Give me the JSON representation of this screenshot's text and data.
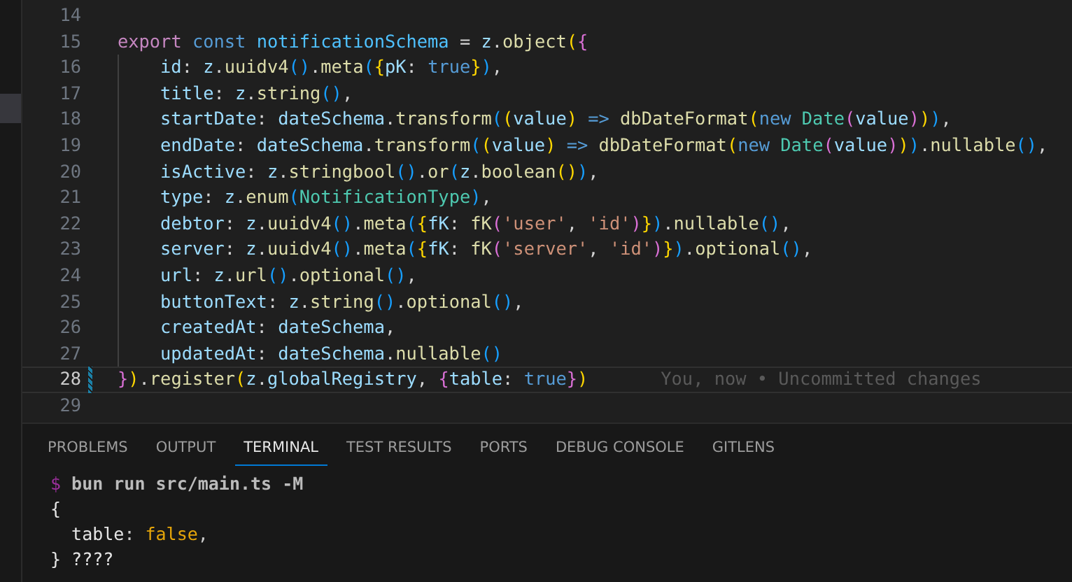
{
  "editor": {
    "lines": [
      {
        "number": "14",
        "current": false,
        "changed": false,
        "indented": false
      },
      {
        "number": "15",
        "current": false,
        "changed": false,
        "indented": false,
        "tokens": [
          {
            "kind": "ctl",
            "text": "export "
          },
          {
            "kind": "kw",
            "text": "const "
          },
          {
            "kind": "const",
            "text": "notificationSchema"
          },
          {
            "kind": "plain",
            "text": " = "
          },
          {
            "kind": "var",
            "text": "z"
          },
          {
            "kind": "plain",
            "text": "."
          },
          {
            "kind": "fn",
            "text": "object"
          },
          {
            "kind": "b1",
            "text": "("
          },
          {
            "kind": "b2",
            "text": "{"
          }
        ]
      },
      {
        "number": "16",
        "current": false,
        "changed": false,
        "indented": true,
        "tokens": [
          {
            "kind": "var",
            "text": "id"
          },
          {
            "kind": "plain",
            "text": ": "
          },
          {
            "kind": "var",
            "text": "z"
          },
          {
            "kind": "plain",
            "text": "."
          },
          {
            "kind": "fn",
            "text": "uuidv4"
          },
          {
            "kind": "b3",
            "text": "()"
          },
          {
            "kind": "plain",
            "text": "."
          },
          {
            "kind": "fn",
            "text": "meta"
          },
          {
            "kind": "b3",
            "text": "("
          },
          {
            "kind": "b1",
            "text": "{"
          },
          {
            "kind": "var",
            "text": "pK"
          },
          {
            "kind": "plain",
            "text": ": "
          },
          {
            "kind": "kw",
            "text": "true"
          },
          {
            "kind": "b1",
            "text": "}"
          },
          {
            "kind": "b3",
            "text": ")"
          },
          {
            "kind": "plain",
            "text": ","
          }
        ]
      },
      {
        "number": "17",
        "current": false,
        "changed": false,
        "indented": true,
        "tokens": [
          {
            "kind": "var",
            "text": "title"
          },
          {
            "kind": "plain",
            "text": ": "
          },
          {
            "kind": "var",
            "text": "z"
          },
          {
            "kind": "plain",
            "text": "."
          },
          {
            "kind": "fn",
            "text": "string"
          },
          {
            "kind": "b3",
            "text": "()"
          },
          {
            "kind": "plain",
            "text": ","
          }
        ]
      },
      {
        "number": "18",
        "current": false,
        "changed": false,
        "indented": true,
        "tokens": [
          {
            "kind": "var",
            "text": "startDate"
          },
          {
            "kind": "plain",
            "text": ": "
          },
          {
            "kind": "var",
            "text": "dateSchema"
          },
          {
            "kind": "plain",
            "text": "."
          },
          {
            "kind": "fn",
            "text": "transform"
          },
          {
            "kind": "b3",
            "text": "("
          },
          {
            "kind": "b1",
            "text": "("
          },
          {
            "kind": "var",
            "text": "value"
          },
          {
            "kind": "b1",
            "text": ")"
          },
          {
            "kind": "kw",
            "text": " => "
          },
          {
            "kind": "fn",
            "text": "dbDateFormat"
          },
          {
            "kind": "b1",
            "text": "("
          },
          {
            "kind": "kw",
            "text": "new "
          },
          {
            "kind": "type",
            "text": "Date"
          },
          {
            "kind": "b2",
            "text": "("
          },
          {
            "kind": "var",
            "text": "value"
          },
          {
            "kind": "b2",
            "text": ")"
          },
          {
            "kind": "b1",
            "text": ")"
          },
          {
            "kind": "b3",
            "text": ")"
          },
          {
            "kind": "plain",
            "text": ","
          }
        ]
      },
      {
        "number": "19",
        "current": false,
        "changed": false,
        "indented": true,
        "tokens": [
          {
            "kind": "var",
            "text": "endDate"
          },
          {
            "kind": "plain",
            "text": ": "
          },
          {
            "kind": "var",
            "text": "dateSchema"
          },
          {
            "kind": "plain",
            "text": "."
          },
          {
            "kind": "fn",
            "text": "transform"
          },
          {
            "kind": "b3",
            "text": "("
          },
          {
            "kind": "b1",
            "text": "("
          },
          {
            "kind": "var",
            "text": "value"
          },
          {
            "kind": "b1",
            "text": ")"
          },
          {
            "kind": "kw",
            "text": " => "
          },
          {
            "kind": "fn",
            "text": "dbDateFormat"
          },
          {
            "kind": "b1",
            "text": "("
          },
          {
            "kind": "kw",
            "text": "new "
          },
          {
            "kind": "type",
            "text": "Date"
          },
          {
            "kind": "b2",
            "text": "("
          },
          {
            "kind": "var",
            "text": "value"
          },
          {
            "kind": "b2",
            "text": ")"
          },
          {
            "kind": "b1",
            "text": ")"
          },
          {
            "kind": "b3",
            "text": ")"
          },
          {
            "kind": "plain",
            "text": "."
          },
          {
            "kind": "fn",
            "text": "nullable"
          },
          {
            "kind": "b3",
            "text": "()"
          },
          {
            "kind": "plain",
            "text": ","
          }
        ]
      },
      {
        "number": "20",
        "current": false,
        "changed": false,
        "indented": true,
        "tokens": [
          {
            "kind": "var",
            "text": "isActive"
          },
          {
            "kind": "plain",
            "text": ": "
          },
          {
            "kind": "var",
            "text": "z"
          },
          {
            "kind": "plain",
            "text": "."
          },
          {
            "kind": "fn",
            "text": "stringbool"
          },
          {
            "kind": "b3",
            "text": "()"
          },
          {
            "kind": "plain",
            "text": "."
          },
          {
            "kind": "fn",
            "text": "or"
          },
          {
            "kind": "b3",
            "text": "("
          },
          {
            "kind": "var",
            "text": "z"
          },
          {
            "kind": "plain",
            "text": "."
          },
          {
            "kind": "fn",
            "text": "boolean"
          },
          {
            "kind": "b1",
            "text": "()"
          },
          {
            "kind": "b3",
            "text": ")"
          },
          {
            "kind": "plain",
            "text": ","
          }
        ]
      },
      {
        "number": "21",
        "current": false,
        "changed": false,
        "indented": true,
        "tokens": [
          {
            "kind": "var",
            "text": "type"
          },
          {
            "kind": "plain",
            "text": ": "
          },
          {
            "kind": "var",
            "text": "z"
          },
          {
            "kind": "plain",
            "text": "."
          },
          {
            "kind": "fn",
            "text": "enum"
          },
          {
            "kind": "b3",
            "text": "("
          },
          {
            "kind": "type",
            "text": "NotificationType"
          },
          {
            "kind": "b3",
            "text": ")"
          },
          {
            "kind": "plain",
            "text": ","
          }
        ]
      },
      {
        "number": "22",
        "current": false,
        "changed": false,
        "indented": true,
        "tokens": [
          {
            "kind": "var",
            "text": "debtor"
          },
          {
            "kind": "plain",
            "text": ": "
          },
          {
            "kind": "var",
            "text": "z"
          },
          {
            "kind": "plain",
            "text": "."
          },
          {
            "kind": "fn",
            "text": "uuidv4"
          },
          {
            "kind": "b3",
            "text": "()"
          },
          {
            "kind": "plain",
            "text": "."
          },
          {
            "kind": "fn",
            "text": "meta"
          },
          {
            "kind": "b3",
            "text": "("
          },
          {
            "kind": "b1",
            "text": "{"
          },
          {
            "kind": "var",
            "text": "fK"
          },
          {
            "kind": "plain",
            "text": ": "
          },
          {
            "kind": "fn",
            "text": "fK"
          },
          {
            "kind": "b2",
            "text": "("
          },
          {
            "kind": "str",
            "text": "'user'"
          },
          {
            "kind": "plain",
            "text": ", "
          },
          {
            "kind": "str",
            "text": "'id'"
          },
          {
            "kind": "b2",
            "text": ")"
          },
          {
            "kind": "b1",
            "text": "}"
          },
          {
            "kind": "b3",
            "text": ")"
          },
          {
            "kind": "plain",
            "text": "."
          },
          {
            "kind": "fn",
            "text": "nullable"
          },
          {
            "kind": "b3",
            "text": "()"
          },
          {
            "kind": "plain",
            "text": ","
          }
        ]
      },
      {
        "number": "23",
        "current": false,
        "changed": false,
        "indented": true,
        "tokens": [
          {
            "kind": "var",
            "text": "server"
          },
          {
            "kind": "plain",
            "text": ": "
          },
          {
            "kind": "var",
            "text": "z"
          },
          {
            "kind": "plain",
            "text": "."
          },
          {
            "kind": "fn",
            "text": "uuidv4"
          },
          {
            "kind": "b3",
            "text": "()"
          },
          {
            "kind": "plain",
            "text": "."
          },
          {
            "kind": "fn",
            "text": "meta"
          },
          {
            "kind": "b3",
            "text": "("
          },
          {
            "kind": "b1",
            "text": "{"
          },
          {
            "kind": "var",
            "text": "fK"
          },
          {
            "kind": "plain",
            "text": ": "
          },
          {
            "kind": "fn",
            "text": "fK"
          },
          {
            "kind": "b2",
            "text": "("
          },
          {
            "kind": "str",
            "text": "'server'"
          },
          {
            "kind": "plain",
            "text": ", "
          },
          {
            "kind": "str",
            "text": "'id'"
          },
          {
            "kind": "b2",
            "text": ")"
          },
          {
            "kind": "b1",
            "text": "}"
          },
          {
            "kind": "b3",
            "text": ")"
          },
          {
            "kind": "plain",
            "text": "."
          },
          {
            "kind": "fn",
            "text": "optional"
          },
          {
            "kind": "b3",
            "text": "()"
          },
          {
            "kind": "plain",
            "text": ","
          }
        ]
      },
      {
        "number": "24",
        "current": false,
        "changed": false,
        "indented": true,
        "tokens": [
          {
            "kind": "var",
            "text": "url"
          },
          {
            "kind": "plain",
            "text": ": "
          },
          {
            "kind": "var",
            "text": "z"
          },
          {
            "kind": "plain",
            "text": "."
          },
          {
            "kind": "fn",
            "text": "url"
          },
          {
            "kind": "b3",
            "text": "()"
          },
          {
            "kind": "plain",
            "text": "."
          },
          {
            "kind": "fn",
            "text": "optional"
          },
          {
            "kind": "b3",
            "text": "()"
          },
          {
            "kind": "plain",
            "text": ","
          }
        ]
      },
      {
        "number": "25",
        "current": false,
        "changed": false,
        "indented": true,
        "tokens": [
          {
            "kind": "var",
            "text": "buttonText"
          },
          {
            "kind": "plain",
            "text": ": "
          },
          {
            "kind": "var",
            "text": "z"
          },
          {
            "kind": "plain",
            "text": "."
          },
          {
            "kind": "fn",
            "text": "string"
          },
          {
            "kind": "b3",
            "text": "()"
          },
          {
            "kind": "plain",
            "text": "."
          },
          {
            "kind": "fn",
            "text": "optional"
          },
          {
            "kind": "b3",
            "text": "()"
          },
          {
            "kind": "plain",
            "text": ","
          }
        ]
      },
      {
        "number": "26",
        "current": false,
        "changed": false,
        "indented": true,
        "tokens": [
          {
            "kind": "var",
            "text": "createdAt"
          },
          {
            "kind": "plain",
            "text": ": "
          },
          {
            "kind": "var",
            "text": "dateSchema"
          },
          {
            "kind": "plain",
            "text": ","
          }
        ]
      },
      {
        "number": "27",
        "current": false,
        "changed": false,
        "indented": true,
        "tokens": [
          {
            "kind": "var",
            "text": "updatedAt"
          },
          {
            "kind": "plain",
            "text": ": "
          },
          {
            "kind": "var",
            "text": "dateSchema"
          },
          {
            "kind": "plain",
            "text": "."
          },
          {
            "kind": "fn",
            "text": "nullable"
          },
          {
            "kind": "b3",
            "text": "()"
          }
        ]
      },
      {
        "number": "28",
        "current": true,
        "changed": true,
        "indented": false,
        "blame": "You, now • Uncommitted changes",
        "tokens": [
          {
            "kind": "b2",
            "text": "}"
          },
          {
            "kind": "b1",
            "text": ")"
          },
          {
            "kind": "plain",
            "text": "."
          },
          {
            "kind": "fn",
            "text": "register"
          },
          {
            "kind": "b1",
            "text": "("
          },
          {
            "kind": "var",
            "text": "z"
          },
          {
            "kind": "plain",
            "text": "."
          },
          {
            "kind": "var",
            "text": "globalRegistry"
          },
          {
            "kind": "plain",
            "text": ", "
          },
          {
            "kind": "b2",
            "text": "{"
          },
          {
            "kind": "var",
            "text": "table"
          },
          {
            "kind": "plain",
            "text": ": "
          },
          {
            "kind": "kw",
            "text": "true"
          },
          {
            "kind": "b2",
            "text": "}"
          },
          {
            "kind": "b1",
            "text": ")"
          }
        ]
      },
      {
        "number": "29",
        "current": false,
        "changed": false,
        "indented": false
      }
    ]
  },
  "panel": {
    "tabs": [
      {
        "label": "PROBLEMS",
        "selected": false
      },
      {
        "label": "OUTPUT",
        "selected": false
      },
      {
        "label": "TERMINAL",
        "selected": true
      },
      {
        "label": "TEST RESULTS",
        "selected": false
      },
      {
        "label": "PORTS",
        "selected": false
      },
      {
        "label": "DEBUG CONSOLE",
        "selected": false
      },
      {
        "label": "GITLENS",
        "selected": false
      }
    ],
    "terminal": [
      [
        {
          "kind": "prompt",
          "text": "$"
        },
        {
          "kind": "cmd",
          "text": " bun run src/main.ts -M"
        }
      ],
      [
        {
          "kind": "out",
          "text": "{"
        }
      ],
      [
        {
          "kind": "out",
          "text": "  table"
        },
        {
          "kind": "dim",
          "text": ": "
        },
        {
          "kind": "bool",
          "text": "false"
        },
        {
          "kind": "dim",
          "text": ","
        }
      ],
      [
        {
          "kind": "out",
          "text": "} ????"
        }
      ]
    ]
  }
}
